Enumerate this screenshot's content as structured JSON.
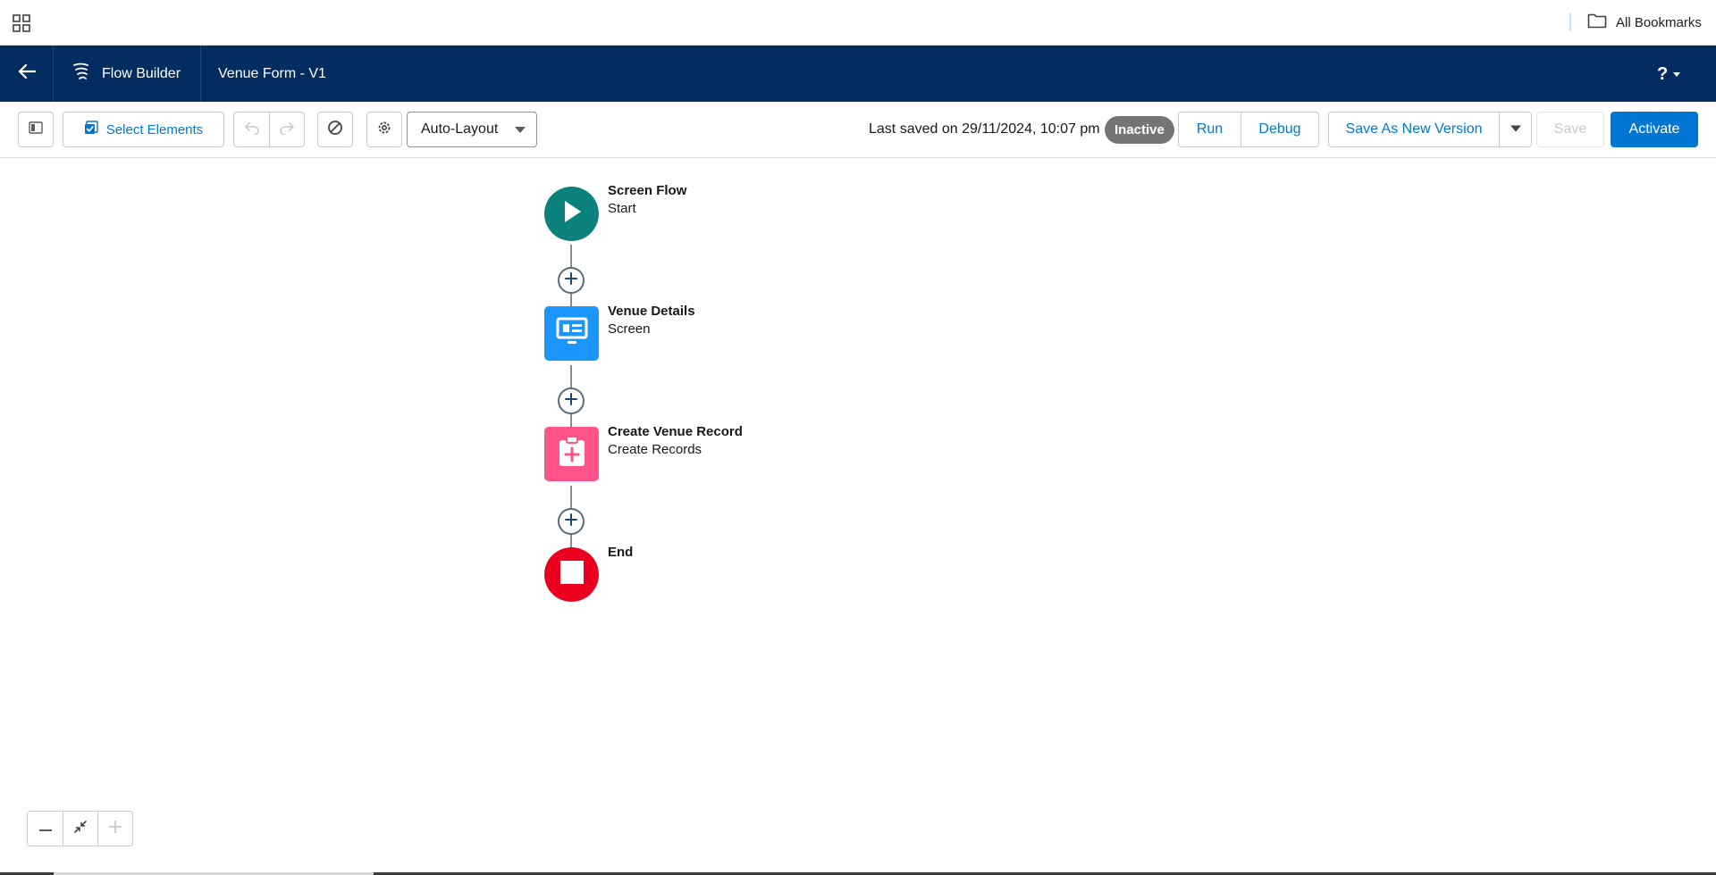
{
  "browser": {
    "apps_icon": "apps-grid-icon",
    "bookmarks_label": "All Bookmarks",
    "bookmarks_icon": "folder-icon"
  },
  "header": {
    "back_icon": "arrow-left-icon",
    "app_icon": "flow-builder-icon",
    "app_title": "Flow Builder",
    "flow_name": "Venue Form - V1",
    "help_label": "?"
  },
  "toolbar": {
    "toggle_panel_icon": "panel-toggle-icon",
    "select_elements_label": "Select Elements",
    "select_elements_icon": "select-check-icon",
    "undo_icon": "undo-icon",
    "redo_icon": "redo-icon",
    "errors_icon": "ban-icon",
    "settings_icon": "gear-icon",
    "layout_mode": "Auto-Layout",
    "last_saved": "Last saved on 29/11/2024, 10:07 pm",
    "status": "Inactive",
    "run_label": "Run",
    "debug_label": "Debug",
    "save_as_new_version_label": "Save As New Version",
    "save_label": "Save",
    "activate_label": "Activate"
  },
  "colors": {
    "header_bg": "#032d60",
    "brand_blue": "#0176d3",
    "start_node": "#0b827c",
    "screen_node": "#1b96ff",
    "create_records_node": "#ff538a",
    "end_node": "#ea001e",
    "status_badge": "#747474"
  },
  "flow": {
    "nodes": [
      {
        "title": "Screen Flow",
        "subtitle": "Start",
        "icon": "play-icon"
      },
      {
        "title": "Venue Details",
        "subtitle": "Screen",
        "icon": "screen-icon"
      },
      {
        "title": "Create Venue Record",
        "subtitle": "Create Records",
        "icon": "record-create-icon"
      },
      {
        "title": "End",
        "subtitle": "",
        "icon": "stop-icon"
      }
    ]
  },
  "zoom": {
    "zoom_out_icon": "minus-icon",
    "fit_icon": "contract-icon",
    "zoom_in_icon": "plus-icon"
  }
}
